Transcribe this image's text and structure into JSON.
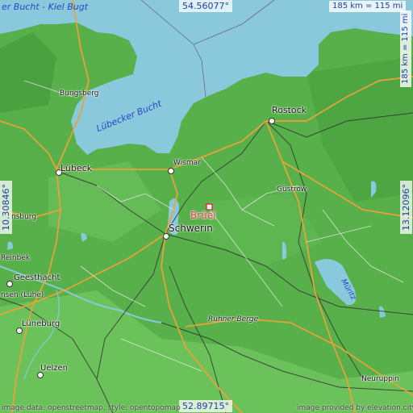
{
  "map": {
    "colors": {
      "water": "#8ac8dc",
      "land": "#4faa45",
      "land_light": "#7bc86a",
      "roads": "#e8a23a",
      "rails": "#333333",
      "marker": "#e0313a"
    },
    "coords": {
      "top": "54.56077°",
      "bottom": "52.89715°",
      "left": "10.30846°",
      "right": "13.12096°"
    },
    "scales": {
      "horizontal": "185 km = 115 mi",
      "vertical": "185 km = 115 mi"
    },
    "water_labels": {
      "kiel_bay": "er Bucht - Kiel Bugt",
      "luebeck_bay": "Lübecker Bucht",
      "mueritz": "Müritz"
    },
    "places": {
      "bungsberg": "Bungsberg",
      "rostock": "Rostock",
      "luebeck": "Lübeck",
      "wismar": "Wismar",
      "guestrow": "Güstrow",
      "brueel": "Brüel",
      "schwerin": "Schwerin",
      "nsburg": "nsburg",
      "reinbek": "Reinbek",
      "geesthacht": "Geesthacht",
      "winsen": "nsen (Luhe)",
      "lueneburg": "Lüneburg",
      "ruhner_berge": "Ruhner Berge",
      "uelzen": "Uelzen",
      "neuruppin": "Neuruppin"
    },
    "credits": {
      "left": "image data: openstreetmap, style: opentopomap",
      "right": "image provided by elevation.city"
    }
  }
}
